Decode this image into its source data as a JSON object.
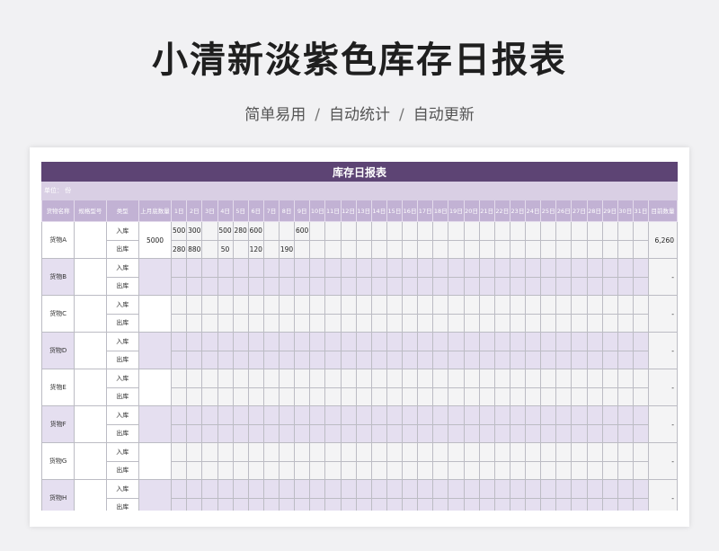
{
  "page": {
    "title": "小清新淡紫色库存日报表",
    "subtitle_parts": [
      "简单易用",
      "自动统计",
      "自动更新"
    ],
    "separator": "/"
  },
  "sheet": {
    "title": "库存日报表",
    "unit_label": "单位： 份",
    "headers": {
      "name": "货物名称",
      "spec": "规格型号",
      "type": "类型",
      "last_month": "上月底数量",
      "days": [
        "1日",
        "2日",
        "3日",
        "4日",
        "5日",
        "6日",
        "7日",
        "8日",
        "9日",
        "10日",
        "11日",
        "12日",
        "13日",
        "14日",
        "15日",
        "16日",
        "17日",
        "18日",
        "19日",
        "20日",
        "21日",
        "22日",
        "23日",
        "24日",
        "25日",
        "26日",
        "27日",
        "28日",
        "29日",
        "30日",
        "31日"
      ],
      "current": "目前数量"
    },
    "row_types": {
      "in": "入库",
      "out": "出库"
    },
    "goods": [
      {
        "name": "货物A",
        "last_month": "5000",
        "in": [
          "500",
          "300",
          "",
          "500",
          "280",
          "600",
          "",
          "",
          "600"
        ],
        "out": [
          "280",
          "880",
          "",
          "50",
          "",
          "120",
          "",
          "190",
          ""
        ],
        "current": "6,260"
      },
      {
        "name": "货物B",
        "last_month": "",
        "in": [],
        "out": [],
        "current": "-"
      },
      {
        "name": "货物C",
        "last_month": "",
        "in": [],
        "out": [],
        "current": "-"
      },
      {
        "name": "货物D",
        "last_month": "",
        "in": [],
        "out": [],
        "current": "-"
      },
      {
        "name": "货物E",
        "last_month": "",
        "in": [],
        "out": [],
        "current": "-"
      },
      {
        "name": "货物F",
        "last_month": "",
        "in": [],
        "out": [],
        "current": "-"
      },
      {
        "name": "货物G",
        "last_month": "",
        "in": [],
        "out": [],
        "current": "-"
      },
      {
        "name": "货物H",
        "last_month": "",
        "in": [],
        "out": [],
        "current": "-"
      }
    ]
  }
}
